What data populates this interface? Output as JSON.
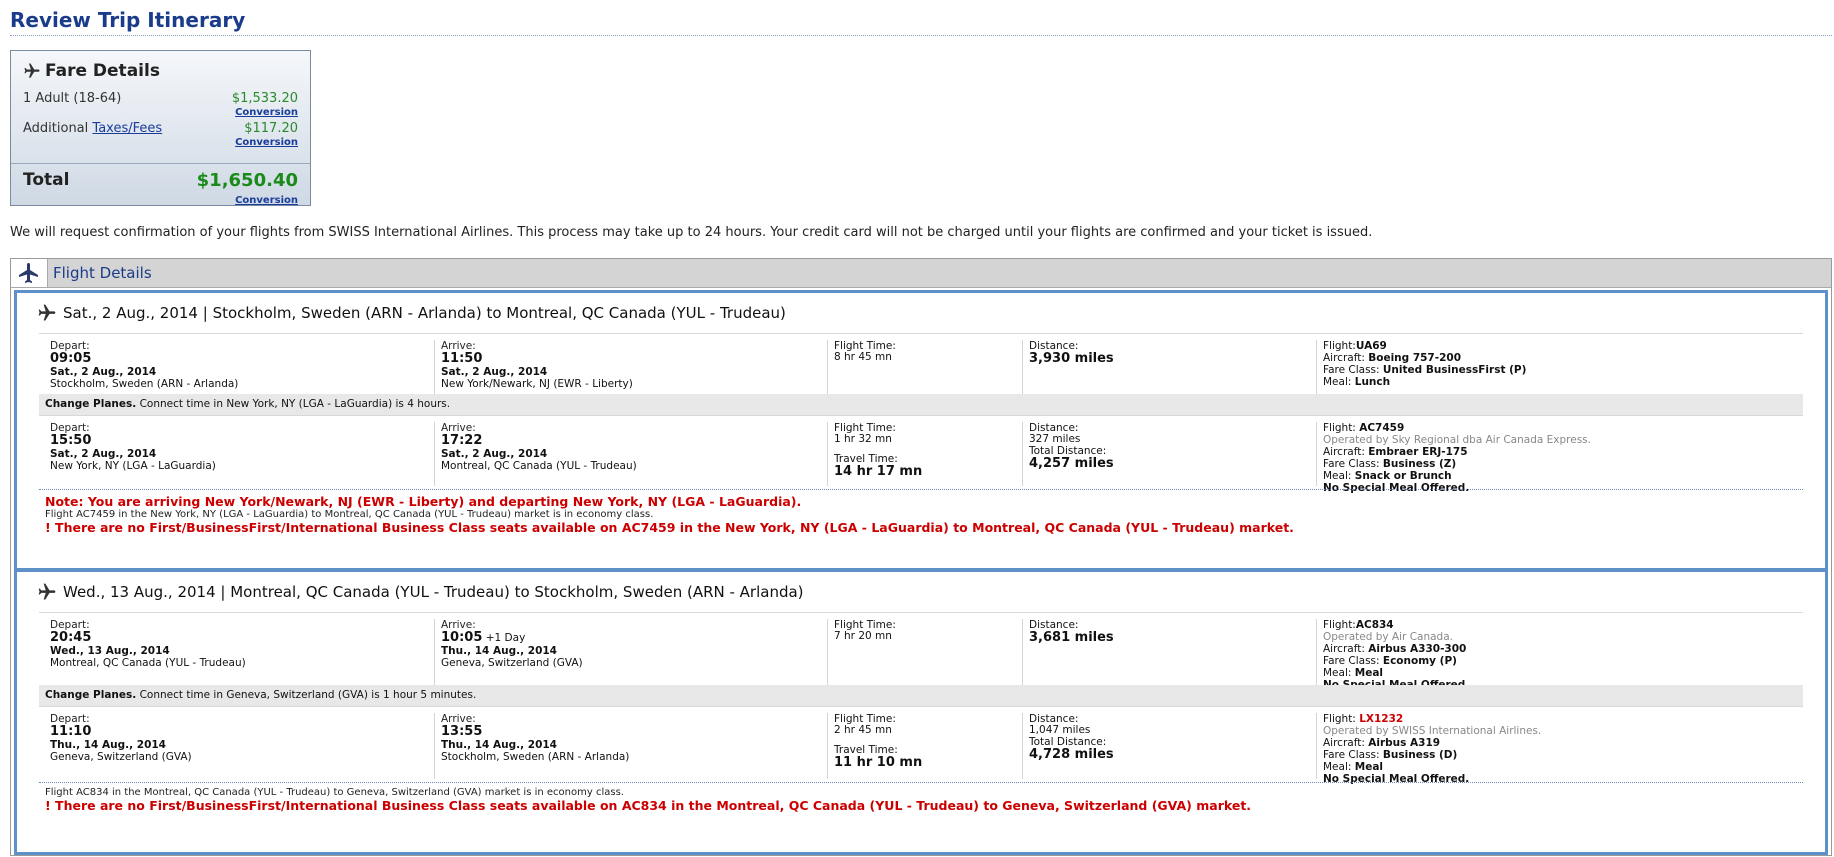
{
  "page_title": "Review Trip Itinerary",
  "fare": {
    "title": "Fare Details",
    "adult_label": "1 Adult (18-64)",
    "adult_amount": "$1,533.20",
    "additional_label": "Additional",
    "taxes_link": "Taxes/Fees",
    "taxes_amount": "$117.20",
    "conversion": "Conversion",
    "total_label": "Total",
    "total_amount": "$1,650.40"
  },
  "notice": "We will request confirmation of your flights from SWISS International Airlines. This process may take up to 24 hours. Your credit card will not be charged until your flights are confirmed and your ticket is issued.",
  "flight_details_title": "Flight Details",
  "labels": {
    "depart": "Depart:",
    "arrive": "Arrive:",
    "flight_time": "Flight Time:",
    "travel_time": "Travel Time:",
    "distance": "Distance:",
    "total_distance": "Total Distance:",
    "flight": "Flight:",
    "aircraft": "Aircraft:",
    "fare_class": "Fare Class:",
    "meal": "Meal:",
    "change_planes": "Change Planes."
  },
  "trip1": {
    "header": "Sat., 2 Aug., 2014 | Stockholm, Sweden (ARN - Arlanda) to Montreal, QC Canada (YUL - Trudeau)",
    "seg1": {
      "depart_time": "09:05",
      "depart_date": "Sat., 2 Aug., 2014",
      "depart_place": "Stockholm, Sweden (ARN - Arlanda)",
      "arrive_time": "11:50",
      "arrive_date": "Sat., 2 Aug., 2014",
      "arrive_place": "New York/Newark, NJ (EWR - Liberty)",
      "flight_time": "8 hr 45 mn",
      "distance": "3,930 miles",
      "flight": "UA69",
      "aircraft": "Boeing 757-200",
      "fare_class": "United BusinessFirst (P)",
      "meal": "Lunch"
    },
    "connection": "Connect time in New York, NY (LGA - LaGuardia) is 4 hours.",
    "seg2": {
      "depart_time": "15:50",
      "depart_date": "Sat., 2 Aug., 2014",
      "depart_place": "New York, NY (LGA - LaGuardia)",
      "arrive_time": "17:22",
      "arrive_date": "Sat., 2 Aug., 2014",
      "arrive_place": "Montreal, QC Canada (YUL - Trudeau)",
      "flight_time": "1 hr 32 mn",
      "travel_time": "14 hr 17 mn",
      "distance": "327 miles",
      "total_distance": "4,257 miles",
      "flight": "AC7459",
      "operated_by": "Operated by Sky Regional dba Air Canada Express.",
      "aircraft": "Embraer ERJ-175",
      "fare_class": "Business (Z)",
      "meal": "Snack or Brunch",
      "special_meal": "No Special Meal Offered."
    },
    "note1": "Note: You are arriving New York/Newark, NJ (EWR - Liberty) and departing New York, NY (LGA - LaGuardia).",
    "note2": "Flight AC7459 in the New York, NY (LGA - LaGuardia) to Montreal, QC Canada (YUL - Trudeau) market is in economy class.",
    "note3": "! There are no First/BusinessFirst/International Business Class seats available on AC7459 in the New York, NY (LGA - LaGuardia) to Montreal, QC Canada (YUL - Trudeau) market."
  },
  "trip2": {
    "header": "Wed., 13 Aug., 2014 | Montreal, QC Canada (YUL - Trudeau) to Stockholm, Sweden (ARN - Arlanda)",
    "seg1": {
      "depart_time": "20:45",
      "depart_date": "Wed., 13 Aug., 2014",
      "depart_place": "Montreal, QC Canada (YUL - Trudeau)",
      "arrive_time": "10:05",
      "arrive_plus": "+1 Day",
      "arrive_date": "Thu., 14 Aug., 2014",
      "arrive_place": "Geneva, Switzerland (GVA)",
      "flight_time": "7 hr 20 mn",
      "distance": "3,681 miles",
      "flight": "AC834",
      "operated_by": "Operated by Air Canada.",
      "aircraft": "Airbus A330-300",
      "fare_class": "Economy (P)",
      "meal": "Meal",
      "special_meal": "No Special Meal Offered."
    },
    "connection": "Connect time in Geneva, Switzerland (GVA) is 1 hour 5 minutes.",
    "seg2": {
      "depart_time": "11:10",
      "depart_date": "Thu., 14 Aug., 2014",
      "depart_place": "Geneva, Switzerland (GVA)",
      "arrive_time": "13:55",
      "arrive_date": "Thu., 14 Aug., 2014",
      "arrive_place": "Stockholm, Sweden (ARN - Arlanda)",
      "flight_time": "2 hr 45 mn",
      "travel_time": "11 hr 10 mn",
      "distance": "1,047 miles",
      "total_distance": "4,728 miles",
      "flight": "LX1232",
      "operated_by": "Operated by SWISS International Airlines.",
      "aircraft": "Airbus A319",
      "fare_class": "Business (D)",
      "meal": "Meal",
      "special_meal": "No Special Meal Offered."
    },
    "note2": "Flight AC834 in the Montreal, QC Canada (YUL - Trudeau) to Geneva, Switzerland (GVA) market is in economy class.",
    "note3": "! There are no First/BusinessFirst/International Business Class seats available on AC834 in the Montreal, QC Canada (YUL - Trudeau) to Geneva, Switzerland (GVA) market."
  },
  "colors": {
    "title_blue": "#1a3c8a",
    "price_green": "#2a8a2a",
    "warning_red": "#cc0000",
    "trip_border": "#5f90c8"
  },
  "icons": [
    "airplane-icon"
  ]
}
